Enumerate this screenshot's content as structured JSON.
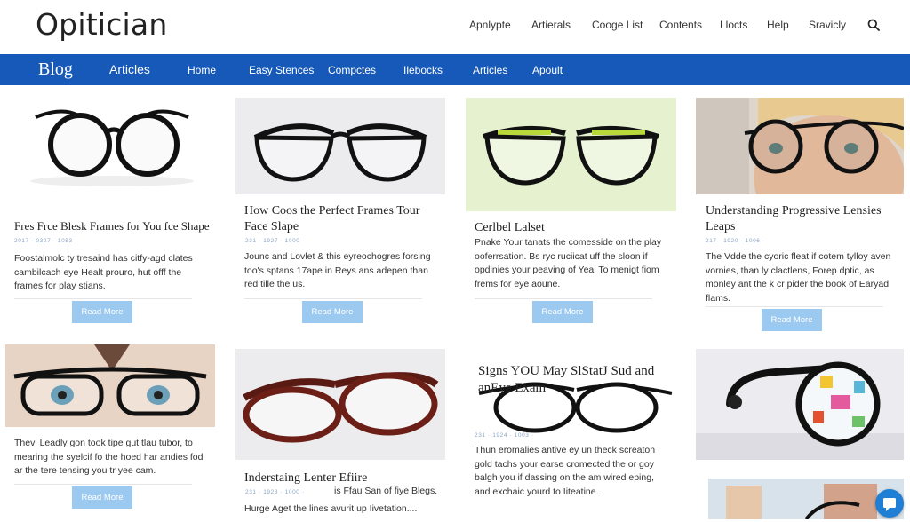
{
  "header": {
    "logo": "Opitician",
    "nav": [
      "Apnlypte",
      "Artierals",
      "Cooge List",
      "Contents",
      "Llocts",
      "Help",
      "Sravicly"
    ]
  },
  "bluebar": {
    "blog": "Blog",
    "articles_main": "Articles",
    "items": [
      "Home",
      "Easy Stences",
      "Compctes",
      "Ilebocks",
      "Articles",
      "Apoult"
    ]
  },
  "cards": [
    {
      "title": "Fres Frce Blesk Frames for You fce Shape",
      "date": "2017 - 0327 - 1083 · ",
      "excerpt": "Foostalmolc ty tresaind has citfy-agd clates cambilcach eye Healt prouro, hut offf the frames for play stians.",
      "read_more": "Read More"
    },
    {
      "title": "How Coos the Perfect Frames Tour Face Slape",
      "date": "231 · 1927 · 1000 · ",
      "excerpt": "Jounc and Lovlet & this eyreochogres forsing too's sptans 17ape in Reys ans adepen than red tille the us.",
      "read_more": "Read More"
    },
    {
      "title": "Cerlbel Lalset",
      "date": "",
      "excerpt": "Pnake Your tanats the comesside on the play ooferrsation. Bs ryc ruciicat uff the sloon if opdinies your peaving of Yeal To menigt fiom frems for eye aoune.",
      "read_more": "Read More"
    },
    {
      "title": "Understanding Progressive Lensies Leaps",
      "date": "217 · 1920 · 1006 · ",
      "excerpt": "The Vdde the cyoric fleat if cotem tylloy aven vornies, than ly clactlens, Forep dptic, as monley ant the k cr pider the book of Earyad flams.",
      "read_more": "Read More"
    },
    {
      "title": "",
      "date": "",
      "excerpt": "Thevl Leadly gon took tipe gut tlau tubor, to mearing the syelcif fo the hoed har andies fod ar the tere tensing you tr yee cam.",
      "read_more": "Read More"
    },
    {
      "title": "Inderstaing Lenter Efiire",
      "date": "231 · 1923 · 1000 · ",
      "meta_right": "is Ffau San of fiye Blegs.",
      "excerpt": "Hurge Aget the lines avurit up Iivetation....",
      "read_more": ""
    },
    {
      "title": "Signs YOU May SlStatJ Sud and anEye Exam",
      "date": "231 · 1924 · 1003 · ",
      "excerpt": "Thun eromalies antive ey un theck screaton gold tachs your earse cromected the or goy balgh you if dassing on the am wired eping, and exchaic yourd to Iiteatine.",
      "read_more": ""
    }
  ],
  "colors": {
    "nav_blue": "#1759b8",
    "button_blue": "#9cc9ef",
    "chat_blue": "#1f7fd4"
  },
  "icons": [
    "search-icon",
    "chat-icon"
  ]
}
